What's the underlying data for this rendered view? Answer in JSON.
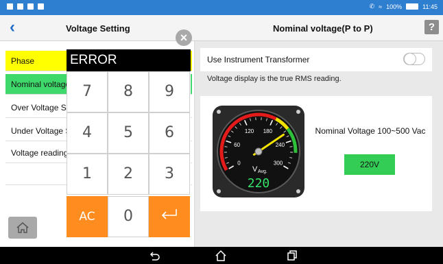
{
  "statusbar": {
    "battery": "100%",
    "time": "11:45"
  },
  "header": {
    "back_icon": "back-chevron-icon",
    "left_title": "Voltage Setting",
    "right_title": "Nominal voltage(P to P)",
    "help_label": "?"
  },
  "sidebar": {
    "items": [
      {
        "label": "Phase"
      },
      {
        "label": "Nominal voltage"
      },
      {
        "label": "Over Voltage Se"
      },
      {
        "label": "Under Voltage S"
      },
      {
        "label": "Voltage reading"
      }
    ],
    "home_icon": "home-icon"
  },
  "keypad": {
    "display": "ERROR",
    "keys": [
      "7",
      "8",
      "9",
      "4",
      "5",
      "6",
      "1",
      "2",
      "3"
    ],
    "clear_label": "AC",
    "zero_label": "0",
    "enter_icon": "enter-arrow-icon",
    "close_label": "×"
  },
  "settings": {
    "transformer_label": "Use Instrument Transformer",
    "transformer_on": false,
    "rms_note": "Voltage display is the true RMS reading."
  },
  "gauge": {
    "ticks": [
      "0",
      "60",
      "120",
      "180",
      "240",
      "300"
    ],
    "unit": "V",
    "unit_sub": "Avg.",
    "reading": "220",
    "colors": {
      "red": "#e31b1b",
      "yellow": "#f2e200",
      "green": "#2fbf3a",
      "digits": "#36e36a"
    }
  },
  "nominal": {
    "text": "Nominal Voltage 100~500 Vac",
    "button": "220V"
  },
  "navbar": {
    "back_icon": "nav-back-icon",
    "home_icon": "nav-home-icon",
    "recent_icon": "nav-recent-icon"
  }
}
